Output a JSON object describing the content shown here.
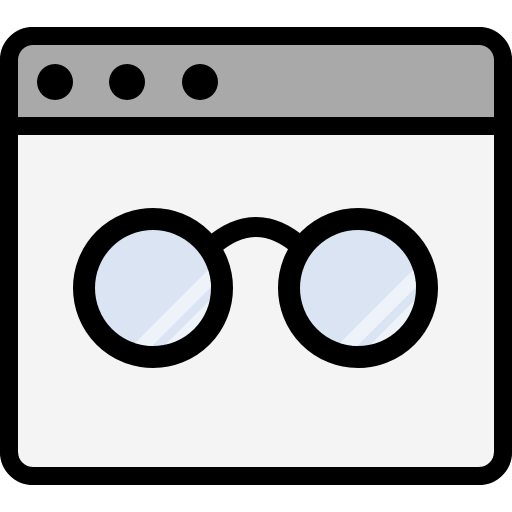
{
  "icon": {
    "name": "incognito-browser-window-icon",
    "depicts": [
      "browser-window",
      "eyeglasses"
    ]
  },
  "window": {
    "title_bar_dots": [
      {
        "name": "window-dot-1"
      },
      {
        "name": "window-dot-2"
      },
      {
        "name": "window-dot-3"
      }
    ]
  },
  "colors": {
    "outline": "#000000",
    "title_bar": "#a9a9a9",
    "window_body": "#f4f4f4",
    "lens_fill": "#dbe4f3",
    "lens_highlight": "#eef2f9"
  }
}
